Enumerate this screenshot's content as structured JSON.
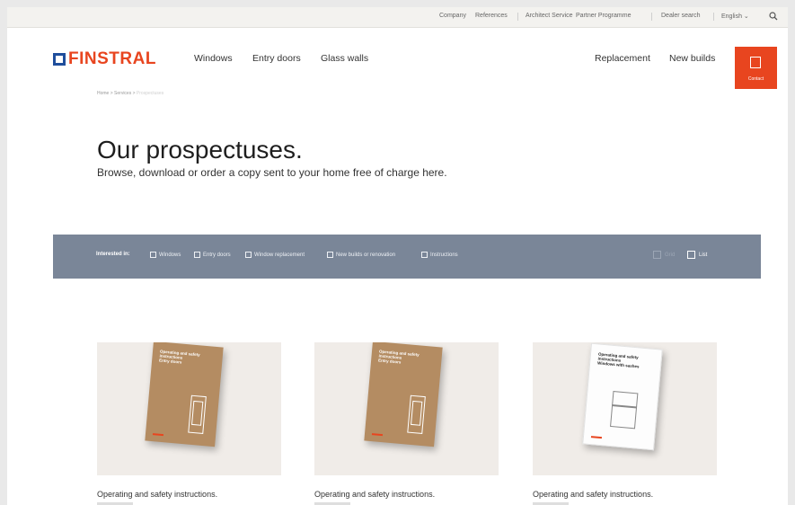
{
  "utility_nav": {
    "items": [
      "Company",
      "References",
      "Architect Service",
      "Partner Programme",
      "Dealer search",
      "English ⌄"
    ]
  },
  "header": {
    "brand": "FINSTRAL",
    "nav_left": [
      "Windows",
      "Entry doors",
      "Glass walls"
    ],
    "nav_right": [
      "Replacement",
      "New builds"
    ],
    "contact_label": "Contact"
  },
  "breadcrumb": {
    "parent": "Home > Services >",
    "current": "Prospectuses"
  },
  "hero": {
    "title": "Our prospectuses.",
    "subtitle": "Browse, download or order a copy sent to your home free of charge here."
  },
  "filters": {
    "label": "Interested in:",
    "options": [
      "Windows",
      "Entry doors",
      "Window replacement",
      "New builds or renovation",
      "Instructions"
    ],
    "view_grid": "Grid",
    "view_list": "List"
  },
  "cards": [
    {
      "book_title": "Operating and safety instructions",
      "book_sub": "Entry doors",
      "caption": "Operating and safety instructions."
    },
    {
      "book_title": "Operating and safety instructions",
      "book_sub": "Entry doors",
      "caption": "Operating and safety instructions."
    },
    {
      "book_title": "Operating and safety instructions",
      "book_sub": "Windows with sashes",
      "caption": "Operating and safety instructions."
    }
  ],
  "colors": {
    "brand_orange": "#e8451f",
    "brand_blue": "#1f4e9c",
    "filter_bar": "#7a8698",
    "card_bg": "#f0ece8"
  }
}
